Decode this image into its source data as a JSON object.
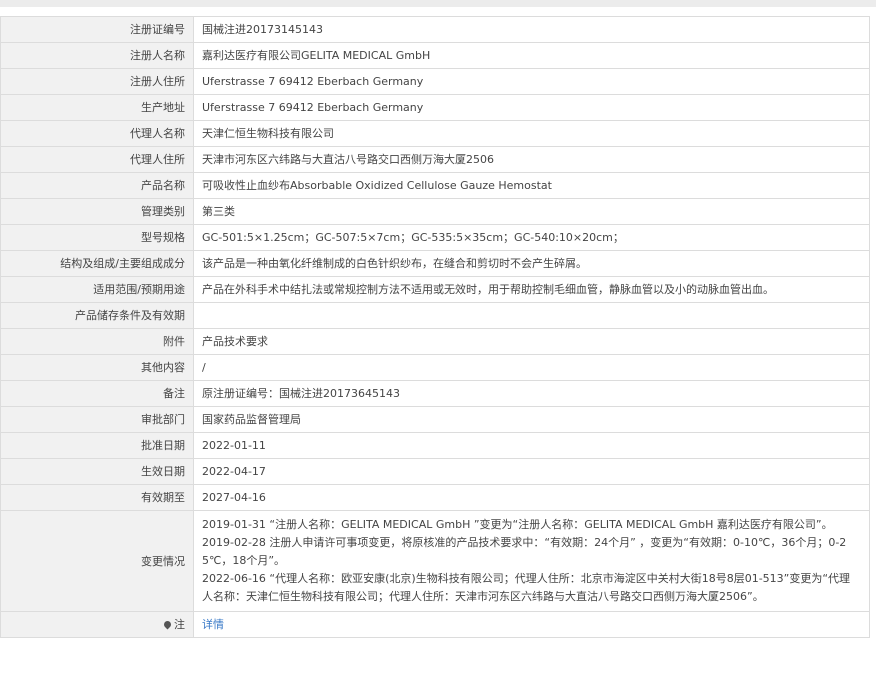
{
  "rows": [
    {
      "label": "注册证编号",
      "value": "国械注进20173145143"
    },
    {
      "label": "注册人名称",
      "value": "嘉利达医疗有限公司GELITA MEDICAL GmbH"
    },
    {
      "label": "注册人住所",
      "value": "Uferstrasse 7 69412 Eberbach Germany"
    },
    {
      "label": "生产地址",
      "value": "Uferstrasse 7 69412 Eberbach Germany"
    },
    {
      "label": "代理人名称",
      "value": "天津仁恒生物科技有限公司"
    },
    {
      "label": "代理人住所",
      "value": "天津市河东区六纬路与大直沽八号路交口西侧万海大厦2506"
    },
    {
      "label": "产品名称",
      "value": "可吸收性止血纱布Absorbable Oxidized Cellulose Gauze Hemostat"
    },
    {
      "label": "管理类别",
      "value": "第三类"
    },
    {
      "label": "型号规格",
      "value": "GC-501:5×1.25cm；GC-507:5×7cm；GC-535:5×35cm；GC-540:10×20cm；"
    },
    {
      "label": "结构及组成/主要组成成分",
      "value": "该产品是一种由氧化纤维制成的白色针织纱布，在缝合和剪切时不会产生碎屑。"
    },
    {
      "label": "适用范围/预期用途",
      "value": "产品在外科手术中结扎法或常规控制方法不适用或无效时，用于帮助控制毛细血管，静脉血管以及小的动脉血管出血。"
    },
    {
      "label": "产品储存条件及有效期",
      "value": ""
    },
    {
      "label": "附件",
      "value": "产品技术要求"
    },
    {
      "label": "其他内容",
      "value": "/"
    },
    {
      "label": "备注",
      "value": "原注册证编号：国械注进20173645143"
    },
    {
      "label": "审批部门",
      "value": "国家药品监督管理局"
    },
    {
      "label": "批准日期",
      "value": "2022-01-11"
    },
    {
      "label": "生效日期",
      "value": "2022-04-17"
    },
    {
      "label": "有效期至",
      "value": "2027-04-16"
    }
  ],
  "changes": {
    "label": "变更情况",
    "lines": [
      "2019-01-31 “注册人名称：GELITA MEDICAL GmbH ”变更为“注册人名称：GELITA MEDICAL GmbH 嘉利达医疗有限公司”。",
      "2019-02-28 注册人申请许可事项变更，将原核准的产品技术要求中：“有效期：24个月”  ，变更为“有效期：0-10℃，36个月；0-25℃，18个月”。",
      "2022-06-16 “代理人名称：欧亚安康(北京)生物科技有限公司；代理人住所：北京市海淀区中关村大街18号8层01-513”变更为“代理人名称：天津仁恒生物科技有限公司；代理人住所：天津市河东区六纬路与大直沽八号路交口西侧万海大厦2506”。"
    ]
  },
  "note": {
    "label": "注",
    "icon": "map-pin-icon",
    "link_text": "详情",
    "link_color": "#3778c7"
  }
}
